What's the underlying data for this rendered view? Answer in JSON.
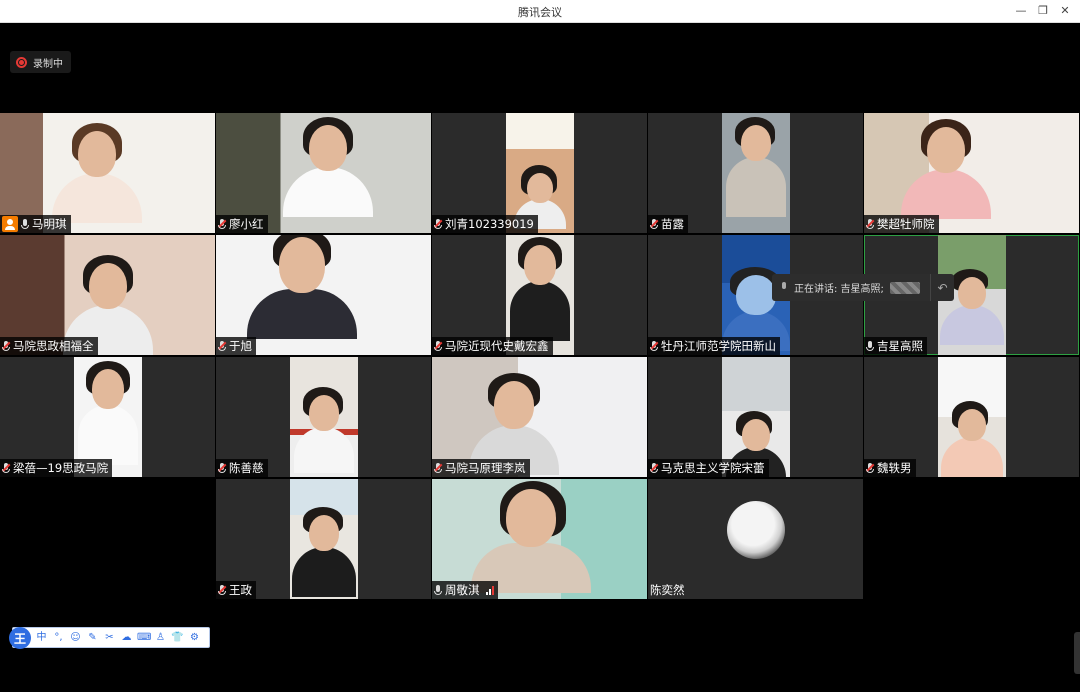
{
  "window": {
    "title": "腾讯会议"
  },
  "recording": {
    "label": "录制中"
  },
  "speaking": {
    "label": "正在讲话: 吉星高照;"
  },
  "participants": [
    {
      "name": "马明琪",
      "host": true,
      "muted": false
    },
    {
      "name": "廖小红",
      "muted": true
    },
    {
      "name": "刘青102339019",
      "muted": true
    },
    {
      "name": "苗露",
      "muted": true
    },
    {
      "name": "樊超牡师院",
      "muted": true
    },
    {
      "name": "马院思政相福全",
      "muted": true
    },
    {
      "name": "于旭",
      "muted": true
    },
    {
      "name": "马院近现代史戴宏鑫",
      "muted": true
    },
    {
      "name": "牡丹江师范学院田新山",
      "muted": true
    },
    {
      "name": "吉星高照",
      "muted": false,
      "speaking": true
    },
    {
      "name": "梁蓓—19思政马院",
      "muted": true
    },
    {
      "name": "陈善慈",
      "muted": true
    },
    {
      "name": "马院马原理李岚",
      "muted": true
    },
    {
      "name": "马克思主义学院宋蕾",
      "muted": true
    },
    {
      "name": "魏轶男",
      "muted": true
    },
    {
      "name": "王政",
      "muted": true
    },
    {
      "name": "周敬淇",
      "muted": false,
      "signal": true
    },
    {
      "name": "陈奕然",
      "video_off": true
    }
  ],
  "ime": {
    "logo": "王",
    "mode": "中"
  }
}
